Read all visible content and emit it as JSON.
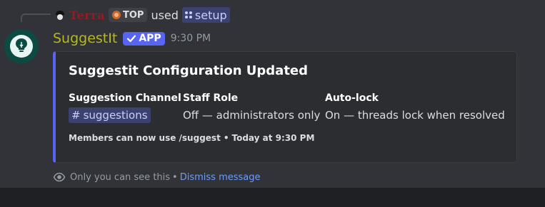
{
  "reply": {
    "username": "Terra",
    "tag": "TOP",
    "used_text": "used",
    "command": "setup"
  },
  "message": {
    "bot_name": "SuggestIt",
    "badge": "APP",
    "timestamp": "9:30 PM"
  },
  "embed": {
    "accent_color": "#5865f2",
    "title": "Suggestit Configuration Updated",
    "fields": [
      {
        "name": "Suggestion Channel",
        "value_hash": "#",
        "value": "suggestions"
      },
      {
        "name": "Staff Role",
        "value": "Off — administrators only"
      },
      {
        "name": "Auto-lock",
        "value": "On — threads lock when resolved"
      }
    ],
    "footer_text": "Members can now use /suggest",
    "footer_sep": "•",
    "footer_time": "Today at 9:30 PM"
  },
  "ephemeral": {
    "notice": "Only you can see this",
    "sep": "•",
    "dismiss": "Dismiss message"
  },
  "icons": {
    "avatar": "lightbulb-avatar-icon",
    "command": "slash-command-icon",
    "badge_check": "check-icon",
    "ephemeral": "eye-icon"
  }
}
